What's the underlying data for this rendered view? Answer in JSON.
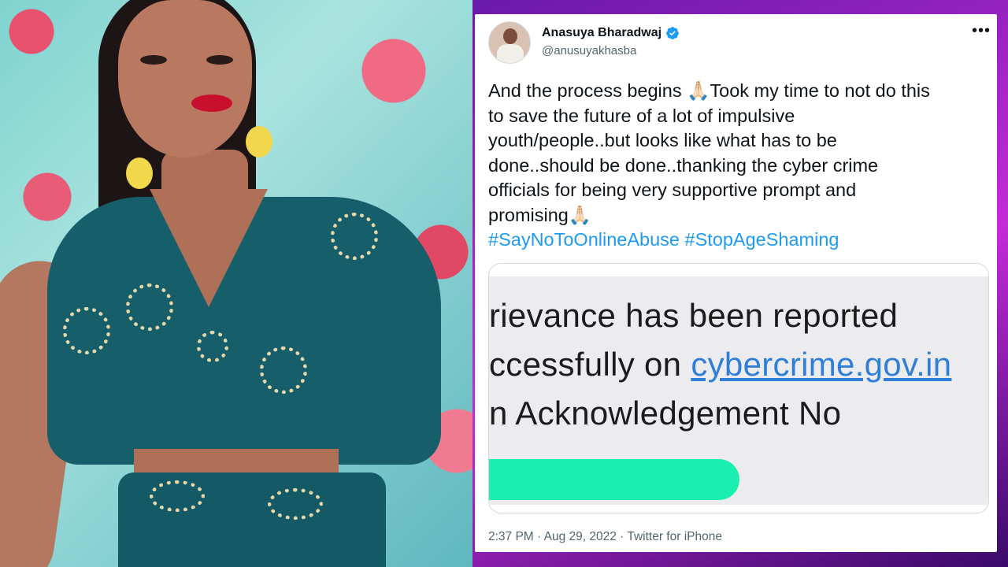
{
  "tweet": {
    "display_name": "Anasuya Bharadwaj",
    "handle": "@anusuyakhasba",
    "more_label": "•••",
    "text_lines": [
      "And the process begins 🙏🏻Took my time to not do this",
      "to save the future of a lot of impulsive",
      "youth/people..but looks like what has to be",
      "done..should be done..thanking the cyber crime",
      "officials for being very supportive prompt and",
      "promising🙏🏻"
    ],
    "hashtags": "#SayNoToOnlineAbuse #StopAgeShaming",
    "media": {
      "line1": "rievance has been reported",
      "line2_prefix": "ccessfully on ",
      "line2_link": "cybercrime.gov.in",
      "line3": "n Acknowledgement No"
    },
    "footer": "2:37 PM · Aug 29, 2022 · Twitter for iPhone"
  },
  "colors": {
    "link": "#1d9bf0",
    "verified": "#1d9bf0",
    "redaction": "#19f0b0",
    "background_accent": "#c42bd9"
  },
  "icons": {
    "verified": "verified-badge-icon",
    "more": "more-options-icon"
  }
}
